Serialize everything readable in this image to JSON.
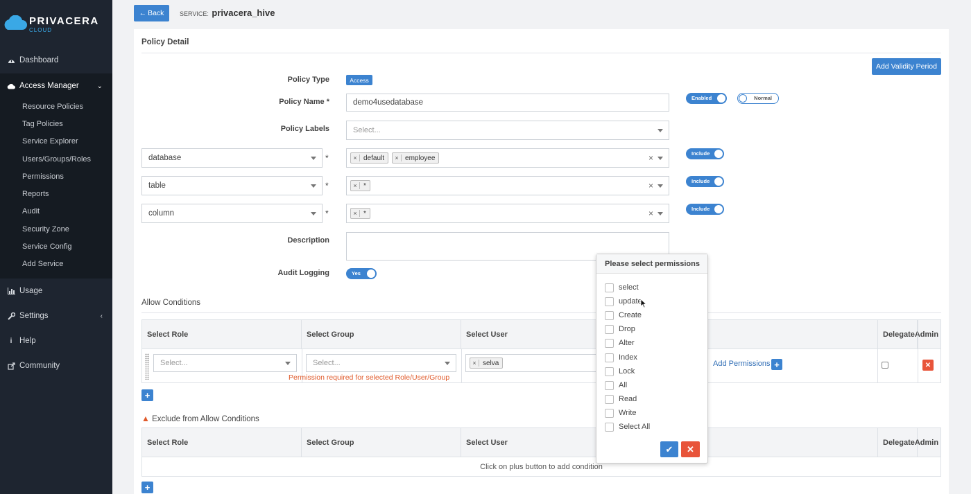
{
  "logo": {
    "brand": "PRIVACERA",
    "sub": "CLOUD"
  },
  "sidebar": {
    "dashboard": "Dashboard",
    "access_manager": "Access Manager",
    "sub_items": [
      "Resource Policies",
      "Tag Policies",
      "Service Explorer",
      "Users/Groups/Roles",
      "Permissions",
      "Reports",
      "Audit",
      "Security Zone",
      "Service Config",
      "Add Service"
    ],
    "usage": "Usage",
    "settings": "Settings",
    "help": "Help",
    "community": "Community"
  },
  "header": {
    "back_label": "Back",
    "service_prefix": "SERVICE:",
    "service_name": "privacera_hive"
  },
  "policy": {
    "title": "Policy Detail",
    "add_validity_label": "Add Validity Period",
    "type_label": "Policy Type",
    "type_value": "Access",
    "name_label": "Policy Name *",
    "name_value": "demo4usedatabase",
    "enabled_toggle": "Enabled",
    "normal_toggle": "Normal",
    "labels_label": "Policy Labels",
    "labels_placeholder": "Select...",
    "resources": [
      {
        "type": "database",
        "tags": [
          "default",
          "employee"
        ],
        "toggle": "Include"
      },
      {
        "type": "table",
        "tags": [
          "*"
        ],
        "toggle": "Include"
      },
      {
        "type": "column",
        "tags": [
          "*"
        ],
        "toggle": "Include"
      }
    ],
    "required_mark": "*",
    "description_label": "Description",
    "audit_label": "Audit Logging",
    "audit_value": "Yes"
  },
  "allow": {
    "title": "Allow Conditions",
    "headers": {
      "role": "Select Role",
      "group": "Select Group",
      "user": "Select User",
      "delegate_line1": "Delegate",
      "delegate_line2": "Admin"
    },
    "role_placeholder": "Select...",
    "group_placeholder": "Select...",
    "user_tag": "selva",
    "add_permissions": "Add Permissions",
    "error": "Permission required for selected Role/User/Group"
  },
  "exclude": {
    "title": "Exclude from Allow Conditions",
    "headers": {
      "role": "Select Role",
      "group": "Select Group",
      "user": "Select User",
      "delegate_line1": "Delegate",
      "delegate_line2": "Admin"
    },
    "empty_msg": "Click on plus button to add condition"
  },
  "permissions_popover": {
    "title": "Please select permissions",
    "options": [
      "select",
      "update",
      "Create",
      "Drop",
      "Alter",
      "Index",
      "Lock",
      "All",
      "Read",
      "Write",
      "Select All"
    ]
  },
  "colors": {
    "primary": "#3c83d0",
    "danger": "#e8543a",
    "sidebar": "#1e2530",
    "error_text": "#e05a2b"
  }
}
